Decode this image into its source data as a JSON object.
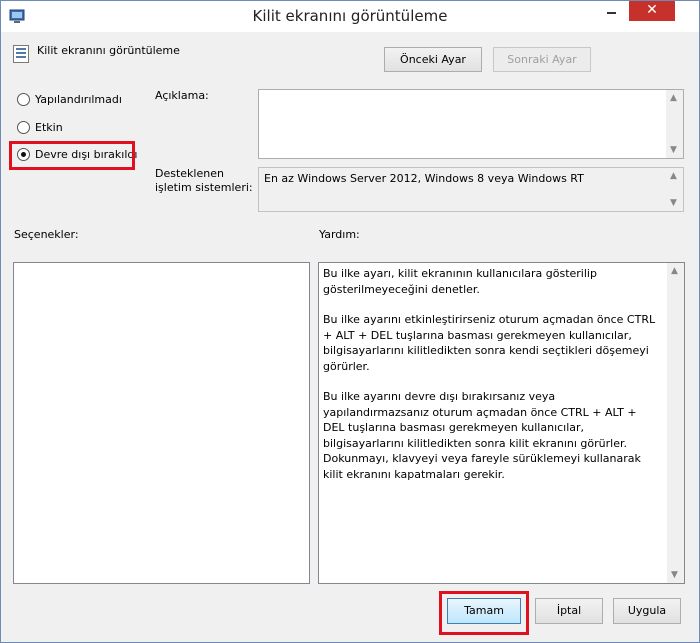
{
  "window": {
    "title": "Kilit ekranını görüntüleme",
    "close_glyph": "✕",
    "minimize_glyph": "—"
  },
  "header": {
    "policy_title": "Kilit ekranını görüntüleme",
    "prev_button": "Önceki Ayar",
    "next_button": "Sonraki Ayar"
  },
  "state_options": [
    {
      "label": "Yapılandırılmadı",
      "checked": false
    },
    {
      "label": "Etkin",
      "checked": false
    },
    {
      "label": "Devre dışı bırakıldı",
      "checked": true
    }
  ],
  "labels": {
    "comment": "Açıklama:",
    "supported_line1": "Desteklenen",
    "supported_line2": "işletim sistemleri:",
    "options": "Seçenekler:",
    "help": "Yardım:"
  },
  "supported_text": "En az Windows Server 2012, Windows 8 veya Windows RT",
  "help_paragraphs": [
    "Bu ilke ayarı, kilit ekranının kullanıcılara gösterilip gösterilmeyeceğini denetler.",
    "Bu ilke ayarını etkinleştirirseniz oturum açmadan önce CTRL + ALT + DEL tuşlarına basması gerekmeyen kullanıcılar, bilgisayarlarını kilitledikten sonra kendi seçtikleri döşemeyi görürler.",
    "Bu ilke ayarını devre dışı bırakırsanız veya yapılandırmazsanız oturum açmadan önce CTRL + ALT + DEL tuşlarına basması gerekmeyen kullanıcılar, bilgisayarlarını kilitledikten sonra kilit ekranını görürler. Dokunmayı, klavyeyi veya fareyle sürüklemeyi kullanarak kilit ekranını kapatmaları gerekir."
  ],
  "footer": {
    "ok": "Tamam",
    "cancel": "İptal",
    "apply": "Uygula"
  },
  "colors": {
    "highlight": "#e0101f",
    "close_button": "#c7312b"
  }
}
